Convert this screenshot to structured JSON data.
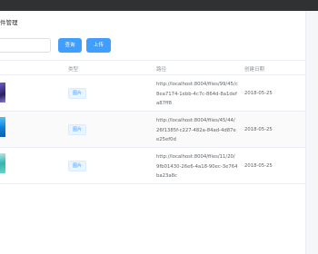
{
  "page": {
    "title": "件管理"
  },
  "toolbar": {
    "search_placeholder": "",
    "search_label": "查询",
    "upload_label": "上传"
  },
  "table": {
    "headers": {
      "type": "类型",
      "path": "路径",
      "created": "创建日期"
    },
    "rows": [
      {
        "type": "图片",
        "path": "http://localhost:8004/files/99/45/c8ea7174-1ebb-4c7c-864d-8a1defa87ff8",
        "created": "2018-05-25",
        "thumb_color": "#4a3d8f"
      },
      {
        "type": "图片",
        "path": "http://localhost:8004/files/45/44/26f1385f-c227-482a-84ad-4d87ee25ef0d",
        "created": "2018-05-25",
        "thumb_color": "#1e9be6"
      },
      {
        "type": "图片",
        "path": "http://localhost:8004/files/11/20/9fb01430-26e6-4a18-90ec-3e764ba23a8c",
        "created": "2018-05-25",
        "thumb_color": "#2fb6b0"
      }
    ]
  }
}
